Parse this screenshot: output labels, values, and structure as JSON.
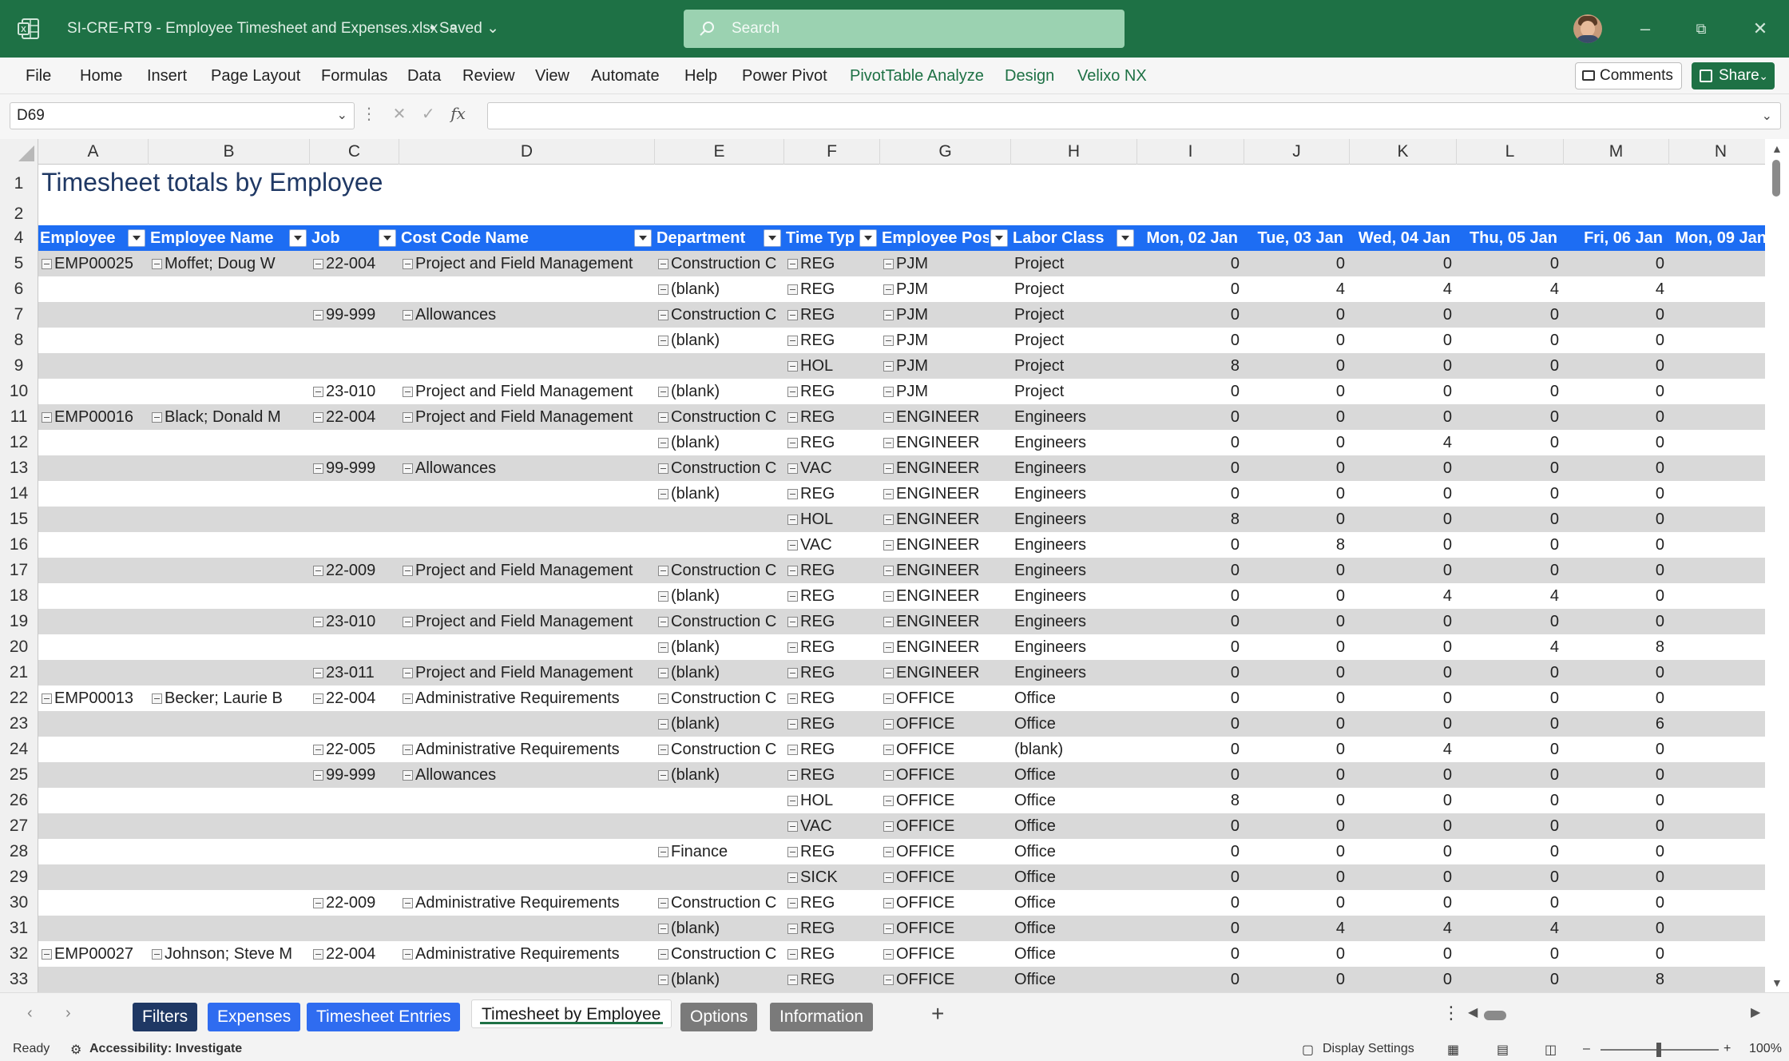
{
  "window": {
    "file_name": "SI-CRE-RT9 - Employee Timesheet and Expenses.xlsx",
    "saved_status": "• Saved",
    "search_placeholder": "Search"
  },
  "menu": [
    "File",
    "Home",
    "Insert",
    "Page Layout",
    "Formulas",
    "Data",
    "Review",
    "View",
    "Automate",
    "Help",
    "Power Pivot",
    "PivotTable Analyze",
    "Design",
    "Velixo NX"
  ],
  "actions": {
    "comments": "Comments",
    "share": "Share"
  },
  "formula_bar": {
    "name_box": "D69",
    "fx": "fx",
    "formula": ""
  },
  "columns": [
    "A",
    "B",
    "C",
    "D",
    "E",
    "F",
    "G",
    "H",
    "I",
    "J",
    "K",
    "L",
    "M",
    "N"
  ],
  "sheet": {
    "title": "Timesheet totals by Employee",
    "header_row_number": "4",
    "headers": [
      "Employee",
      "Employee Name",
      "Job",
      "Cost Code Name",
      "Department",
      "Time Typ",
      "Employee Pos",
      "Labor Class",
      "Mon, 02 Jan",
      "Tue, 03 Jan",
      "Wed, 04 Jan",
      "Thu, 05 Jan",
      "Fri, 06 Jan",
      "Mon, 09 Jan"
    ],
    "rows": [
      {
        "n": "5",
        "emp": "EMP00025",
        "name": "Moffet; Doug W",
        "job": "22-004",
        "cost": "Project and Field Management",
        "dept": "Construction C",
        "type": "REG",
        "pos": "PJM",
        "lc": "Project",
        "v": [
          "0",
          "0",
          "0",
          "0",
          "0"
        ]
      },
      {
        "n": "6",
        "emp": "",
        "name": "",
        "job": "",
        "cost": "",
        "dept": "(blank)",
        "type": "REG",
        "pos": "PJM",
        "lc": "Project",
        "v": [
          "0",
          "4",
          "4",
          "4",
          "4"
        ]
      },
      {
        "n": "7",
        "emp": "",
        "name": "",
        "job": "99-999",
        "cost": "Allowances",
        "dept": "Construction C",
        "type": "REG",
        "pos": "PJM",
        "lc": "Project",
        "v": [
          "0",
          "0",
          "0",
          "0",
          "0"
        ]
      },
      {
        "n": "8",
        "emp": "",
        "name": "",
        "job": "",
        "cost": "",
        "dept": "(blank)",
        "type": "REG",
        "pos": "PJM",
        "lc": "Project",
        "v": [
          "0",
          "0",
          "0",
          "0",
          "0"
        ]
      },
      {
        "n": "9",
        "emp": "",
        "name": "",
        "job": "",
        "cost": "",
        "dept": "",
        "type": "HOL",
        "pos": "PJM",
        "lc": "Project",
        "v": [
          "8",
          "0",
          "0",
          "0",
          "0"
        ]
      },
      {
        "n": "10",
        "emp": "",
        "name": "",
        "job": "23-010",
        "cost": "Project and Field Management",
        "dept": "(blank)",
        "type": "REG",
        "pos": "PJM",
        "lc": "Project",
        "v": [
          "0",
          "0",
          "0",
          "0",
          "0"
        ]
      },
      {
        "n": "11",
        "emp": "EMP00016",
        "name": "Black; Donald M",
        "job": "22-004",
        "cost": "Project and Field Management",
        "dept": "Construction C",
        "type": "REG",
        "pos": "ENGINEER",
        "lc": "Engineers",
        "v": [
          "0",
          "0",
          "0",
          "0",
          "0"
        ]
      },
      {
        "n": "12",
        "emp": "",
        "name": "",
        "job": "",
        "cost": "",
        "dept": "(blank)",
        "type": "REG",
        "pos": "ENGINEER",
        "lc": "Engineers",
        "v": [
          "0",
          "0",
          "4",
          "0",
          "0"
        ]
      },
      {
        "n": "13",
        "emp": "",
        "name": "",
        "job": "99-999",
        "cost": "Allowances",
        "dept": "Construction C",
        "type": "VAC",
        "pos": "ENGINEER",
        "lc": "Engineers",
        "v": [
          "0",
          "0",
          "0",
          "0",
          "0"
        ]
      },
      {
        "n": "14",
        "emp": "",
        "name": "",
        "job": "",
        "cost": "",
        "dept": "(blank)",
        "type": "REG",
        "pos": "ENGINEER",
        "lc": "Engineers",
        "v": [
          "0",
          "0",
          "0",
          "0",
          "0"
        ]
      },
      {
        "n": "15",
        "emp": "",
        "name": "",
        "job": "",
        "cost": "",
        "dept": "",
        "type": "HOL",
        "pos": "ENGINEER",
        "lc": "Engineers",
        "v": [
          "8",
          "0",
          "0",
          "0",
          "0"
        ]
      },
      {
        "n": "16",
        "emp": "",
        "name": "",
        "job": "",
        "cost": "",
        "dept": "",
        "type": "VAC",
        "pos": "ENGINEER",
        "lc": "Engineers",
        "v": [
          "0",
          "8",
          "0",
          "0",
          "0"
        ]
      },
      {
        "n": "17",
        "emp": "",
        "name": "",
        "job": "22-009",
        "cost": "Project and Field Management",
        "dept": "Construction C",
        "type": "REG",
        "pos": "ENGINEER",
        "lc": "Engineers",
        "v": [
          "0",
          "0",
          "0",
          "0",
          "0"
        ]
      },
      {
        "n": "18",
        "emp": "",
        "name": "",
        "job": "",
        "cost": "",
        "dept": "(blank)",
        "type": "REG",
        "pos": "ENGINEER",
        "lc": "Engineers",
        "v": [
          "0",
          "0",
          "4",
          "4",
          "0"
        ]
      },
      {
        "n": "19",
        "emp": "",
        "name": "",
        "job": "23-010",
        "cost": "Project and Field Management",
        "dept": "Construction C",
        "type": "REG",
        "pos": "ENGINEER",
        "lc": "Engineers",
        "v": [
          "0",
          "0",
          "0",
          "0",
          "0"
        ]
      },
      {
        "n": "20",
        "emp": "",
        "name": "",
        "job": "",
        "cost": "",
        "dept": "(blank)",
        "type": "REG",
        "pos": "ENGINEER",
        "lc": "Engineers",
        "v": [
          "0",
          "0",
          "0",
          "4",
          "8"
        ]
      },
      {
        "n": "21",
        "emp": "",
        "name": "",
        "job": "23-011",
        "cost": "Project and Field Management",
        "dept": "(blank)",
        "type": "REG",
        "pos": "ENGINEER",
        "lc": "Engineers",
        "v": [
          "0",
          "0",
          "0",
          "0",
          "0"
        ]
      },
      {
        "n": "22",
        "emp": "EMP00013",
        "name": "Becker; Laurie B",
        "job": "22-004",
        "cost": "Administrative Requirements",
        "dept": "Construction C",
        "type": "REG",
        "pos": "OFFICE",
        "lc": "Office",
        "v": [
          "0",
          "0",
          "0",
          "0",
          "0"
        ]
      },
      {
        "n": "23",
        "emp": "",
        "name": "",
        "job": "",
        "cost": "",
        "dept": "(blank)",
        "type": "REG",
        "pos": "OFFICE",
        "lc": "Office",
        "v": [
          "0",
          "0",
          "0",
          "0",
          "6"
        ]
      },
      {
        "n": "24",
        "emp": "",
        "name": "",
        "job": "22-005",
        "cost": "Administrative Requirements",
        "dept": "Construction C",
        "type": "REG",
        "pos": "OFFICE",
        "lc": "(blank)",
        "v": [
          "0",
          "0",
          "4",
          "0",
          "0"
        ]
      },
      {
        "n": "25",
        "emp": "",
        "name": "",
        "job": "99-999",
        "cost": "Allowances",
        "dept": "(blank)",
        "type": "REG",
        "pos": "OFFICE",
        "lc": "Office",
        "v": [
          "0",
          "0",
          "0",
          "0",
          "0"
        ]
      },
      {
        "n": "26",
        "emp": "",
        "name": "",
        "job": "",
        "cost": "",
        "dept": "",
        "type": "HOL",
        "pos": "OFFICE",
        "lc": "Office",
        "v": [
          "8",
          "0",
          "0",
          "0",
          "0"
        ]
      },
      {
        "n": "27",
        "emp": "",
        "name": "",
        "job": "",
        "cost": "",
        "dept": "",
        "type": "VAC",
        "pos": "OFFICE",
        "lc": "Office",
        "v": [
          "0",
          "0",
          "0",
          "0",
          "0"
        ]
      },
      {
        "n": "28",
        "emp": "",
        "name": "",
        "job": "",
        "cost": "",
        "dept": "Finance",
        "type": "REG",
        "pos": "OFFICE",
        "lc": "Office",
        "v": [
          "0",
          "0",
          "0",
          "0",
          "0"
        ]
      },
      {
        "n": "29",
        "emp": "",
        "name": "",
        "job": "",
        "cost": "",
        "dept": "",
        "type": "SICK",
        "pos": "OFFICE",
        "lc": "Office",
        "v": [
          "0",
          "0",
          "0",
          "0",
          "0"
        ]
      },
      {
        "n": "30",
        "emp": "",
        "name": "",
        "job": "22-009",
        "cost": "Administrative Requirements",
        "dept": "Construction C",
        "type": "REG",
        "pos": "OFFICE",
        "lc": "Office",
        "v": [
          "0",
          "0",
          "0",
          "0",
          "0"
        ]
      },
      {
        "n": "31",
        "emp": "",
        "name": "",
        "job": "",
        "cost": "",
        "dept": "(blank)",
        "type": "REG",
        "pos": "OFFICE",
        "lc": "Office",
        "v": [
          "0",
          "4",
          "4",
          "4",
          "0"
        ]
      },
      {
        "n": "32",
        "emp": "EMP00027",
        "name": "Johnson; Steve M",
        "job": "22-004",
        "cost": "Administrative Requirements",
        "dept": "Construction C",
        "type": "REG",
        "pos": "OFFICE",
        "lc": "Office",
        "v": [
          "0",
          "0",
          "0",
          "0",
          "0"
        ]
      },
      {
        "n": "33",
        "emp": "",
        "name": "",
        "job": "",
        "cost": "",
        "dept": "(blank)",
        "type": "REG",
        "pos": "OFFICE",
        "lc": "Office",
        "v": [
          "0",
          "0",
          "0",
          "0",
          "8"
        ]
      }
    ]
  },
  "tabs": [
    {
      "label": "Filters",
      "style": "blue-dark"
    },
    {
      "label": "Expenses",
      "style": "blue"
    },
    {
      "label": "Timesheet Entries",
      "style": "blue"
    },
    {
      "label": "Timesheet by Employee",
      "style": "active"
    },
    {
      "label": "Options",
      "style": "gray"
    },
    {
      "label": "Information",
      "style": "gray"
    }
  ],
  "status": {
    "ready": "Ready",
    "accessibility": "Accessibility: Investigate",
    "display_settings": "Display Settings",
    "zoom": "100%"
  },
  "colors": {
    "titlebar": "#1e7145",
    "header_blue": "#1d6df3",
    "band_gray": "#d9d9d9"
  },
  "icons": [
    "excel-logo-icon",
    "search-icon",
    "minimize-icon",
    "restore-icon",
    "close-icon",
    "comment-icon",
    "share-icon",
    "dropdown-chevron-icon",
    "cancel-icon",
    "enter-icon",
    "function-icon",
    "collapse-icon",
    "filter-dropdown-icon",
    "add-sheet-icon"
  ]
}
